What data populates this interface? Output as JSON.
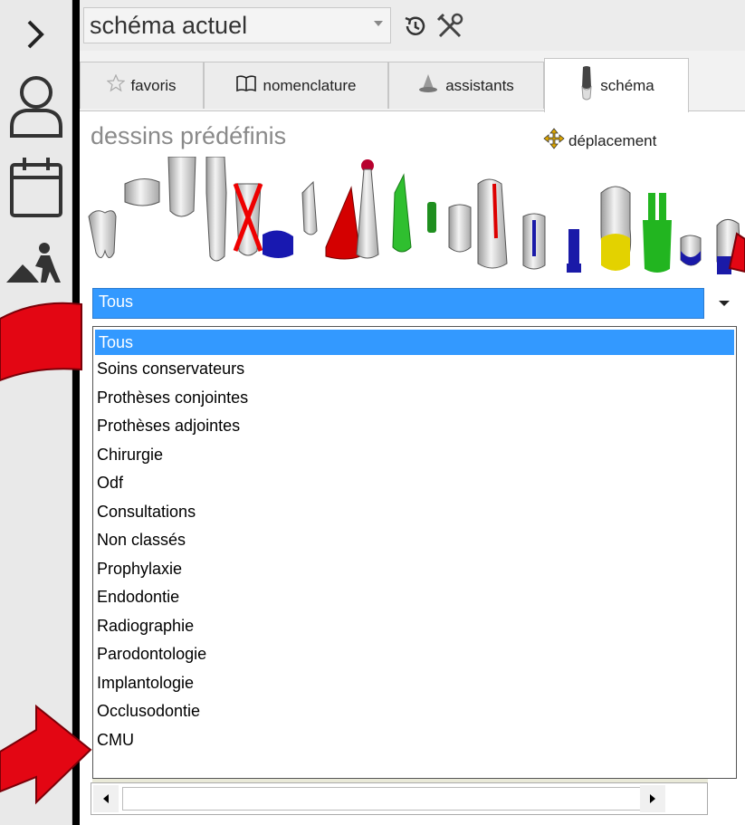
{
  "rail": {
    "icons": [
      "chevron-right-icon",
      "user-icon",
      "calendar-icon",
      "worker-icon"
    ]
  },
  "header": {
    "schema_select_value": "schéma actuel",
    "history_icon": "history-icon",
    "tools_icon": "tools-icon"
  },
  "tabs": [
    {
      "label": "favoris",
      "icon": "star-icon",
      "active": false
    },
    {
      "label": "nomenclature",
      "icon": "book-icon",
      "active": false
    },
    {
      "label": "assistants",
      "icon": "wizard-hat-icon",
      "active": false
    },
    {
      "label": "schéma",
      "icon": "tooth-icon",
      "active": true
    }
  ],
  "content": {
    "section_title": "dessins prédéfinis",
    "move_label": "déplacement"
  },
  "filter": {
    "selected": "Tous",
    "options": [
      "Tous",
      "Soins conservateurs",
      "Prothèses conjointes",
      "Prothèses adjointes",
      "Chirurgie",
      "Odf",
      "Consultations",
      "Non classés",
      "Prophylaxie",
      "Endodontie",
      "Radiographie",
      "Parodontologie",
      "Implantologie",
      "Occlusodontie",
      "CMU"
    ]
  },
  "colors": {
    "selection": "#3399ff",
    "annotation_arrow": "#e30613",
    "crown_yellow": "#e3d200",
    "crown_green": "#22b520",
    "post_blue": "#1a1aa8"
  }
}
